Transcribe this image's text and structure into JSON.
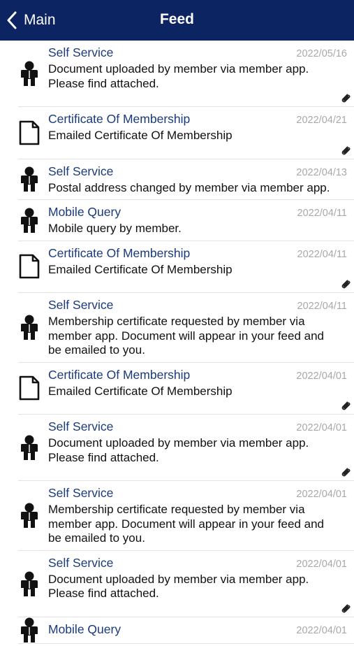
{
  "nav": {
    "back_label": "Main",
    "title": "Feed",
    "background": "#0c2461"
  },
  "colors": {
    "item_title": "#1a3a7a",
    "date": "#a8a8a8",
    "text": "#111111",
    "divider": "#e3e3e3"
  },
  "items": [
    {
      "icon": "person-icon",
      "title": "Self Service",
      "date": "2022/05/16",
      "desc": "Document uploaded by member via member app. Please find attached.",
      "attachment": true
    },
    {
      "icon": "document-icon",
      "title": "Certificate Of Membership",
      "date": "2022/04/21",
      "desc": "Emailed Certificate Of Membership",
      "attachment": true
    },
    {
      "icon": "person-icon",
      "title": "Self Service",
      "date": "2022/04/13",
      "desc": "Postal address changed by member via member app.",
      "attachment": false
    },
    {
      "icon": "person-icon",
      "title": "Mobile Query",
      "date": "2022/04/11",
      "desc": "Mobile query by member.",
      "attachment": false
    },
    {
      "icon": "document-icon",
      "title": "Certificate Of Membership",
      "date": "2022/04/11",
      "desc": "Emailed Certificate Of Membership",
      "attachment": true
    },
    {
      "icon": "person-icon",
      "title": "Self Service",
      "date": "2022/04/11",
      "desc": "Membership certificate requested by member via member app. Document will appear in your feed and be emailed to you.",
      "attachment": false
    },
    {
      "icon": "document-icon",
      "title": "Certificate Of Membership",
      "date": "2022/04/01",
      "desc": "Emailed Certificate Of Membership",
      "attachment": true
    },
    {
      "icon": "person-icon",
      "title": "Self Service",
      "date": "2022/04/01",
      "desc": "Document uploaded by member via member app. Please find attached.",
      "attachment": true
    },
    {
      "icon": "person-icon",
      "title": "Self Service",
      "date": "2022/04/01",
      "desc": "Membership certificate requested by member via member app. Document will appear in your feed and be emailed to you.",
      "attachment": false
    },
    {
      "icon": "person-icon",
      "title": "Self Service",
      "date": "2022/04/01",
      "desc": "Document uploaded by member via member app. Please find attached.",
      "attachment": true
    },
    {
      "icon": "person-icon",
      "title": "Mobile Query",
      "date": "2022/04/01",
      "desc": "",
      "attachment": false
    }
  ]
}
